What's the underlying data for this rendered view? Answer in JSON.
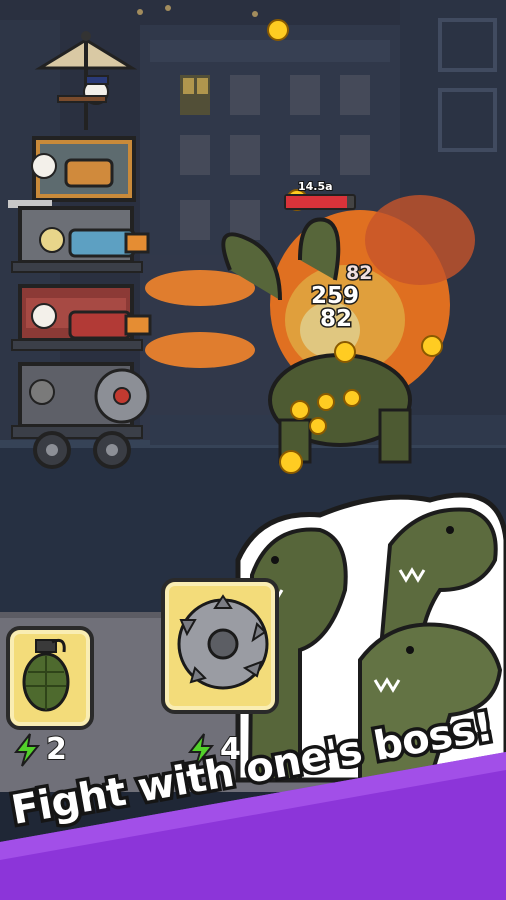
{
  "boss": {
    "hp_label": "14.5a",
    "hp_fraction": 0.9
  },
  "damage_numbers": [
    "82",
    "259",
    "82"
  ],
  "skills": [
    {
      "name": "grenade",
      "icon": "grenade-icon",
      "cost": "2"
    },
    {
      "name": "saw",
      "icon": "saw-blade-icon",
      "cost": "4"
    }
  ],
  "banner": {
    "text": "Fight with one's boss!"
  },
  "colors": {
    "banner_purple": "#8c35d9",
    "card_gold": "#f3dc7a",
    "energy_green": "#52d12a",
    "fire": "#ff7a1a"
  }
}
